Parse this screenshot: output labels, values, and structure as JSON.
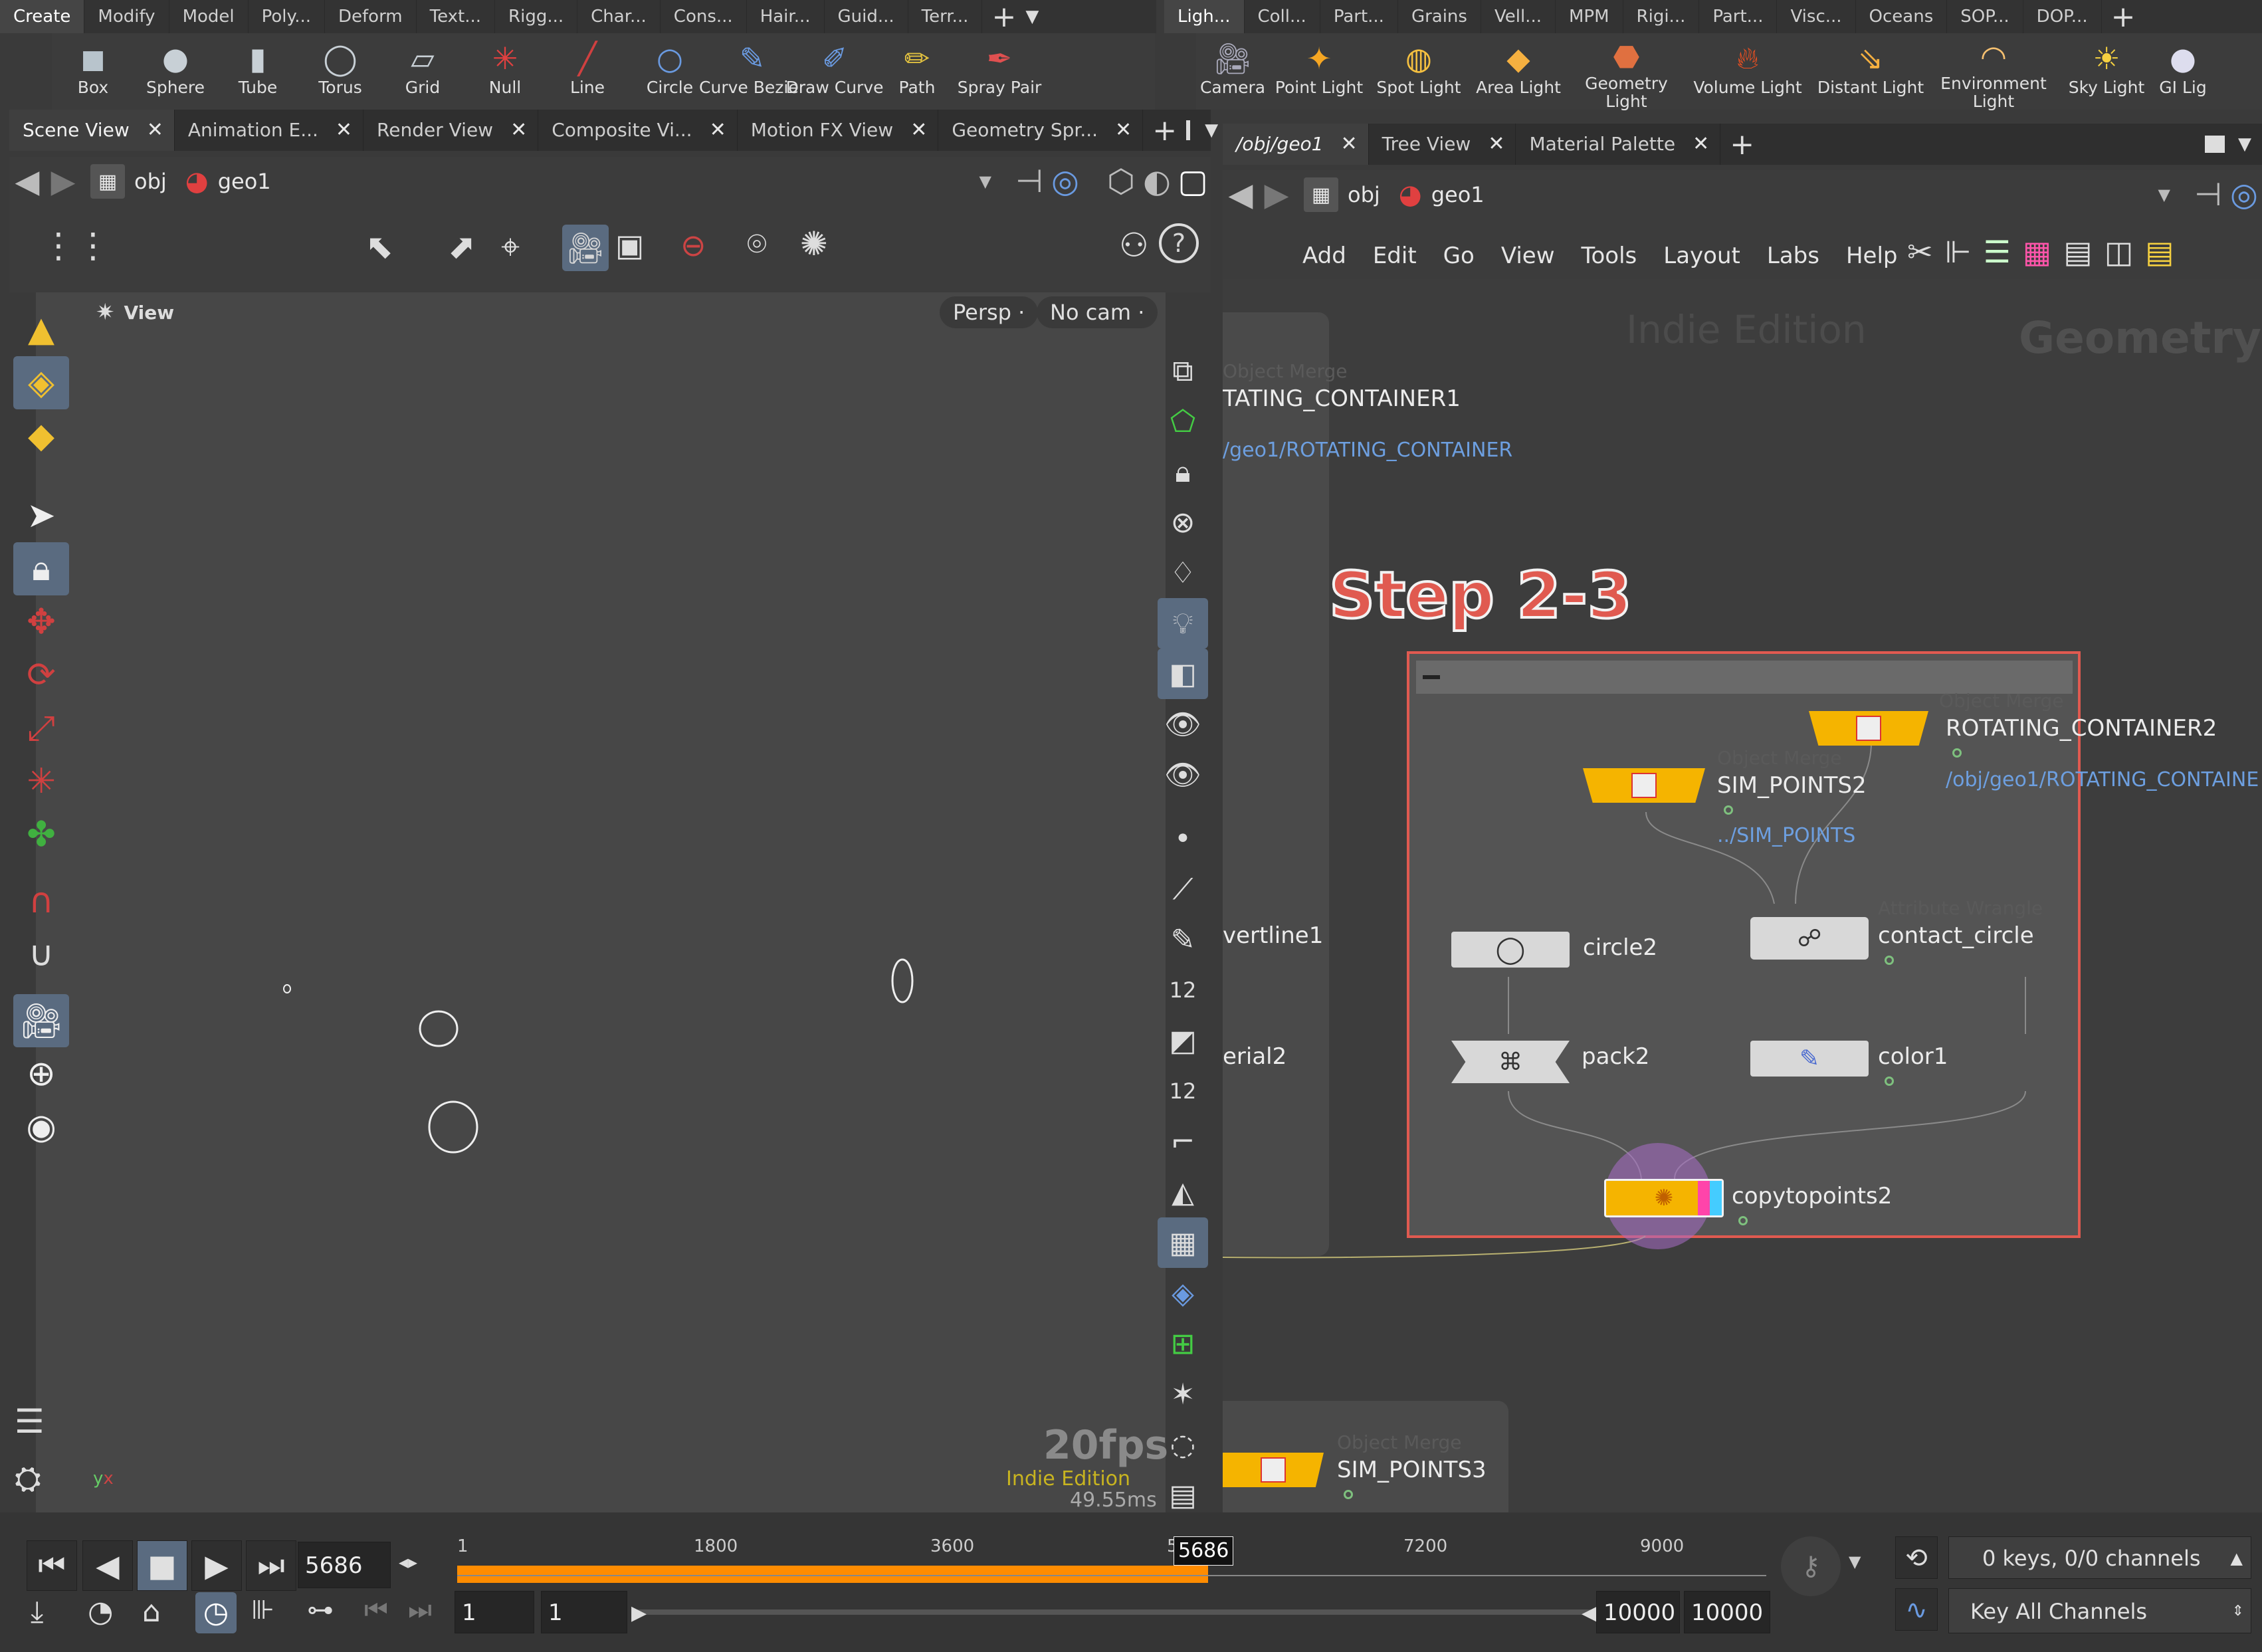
{
  "shelf_left": {
    "tabs": [
      "Create",
      "Modify",
      "Model",
      "Poly...",
      "Deform",
      "Text...",
      "Rigg...",
      "Char...",
      "Cons...",
      "Hair...",
      "Guid...",
      "Terr..."
    ],
    "tools": [
      "Box",
      "Sphere",
      "Tube",
      "Torus",
      "Grid",
      "Null",
      "Line",
      "Circle",
      "Curve Bezier",
      "Draw Curve",
      "Path",
      "Spray Pair"
    ]
  },
  "shelf_right": {
    "tabs": [
      "Ligh...",
      "Coll...",
      "Part...",
      "Grains",
      "Vell...",
      "MPM",
      "Rigi...",
      "Part...",
      "Visc...",
      "Oceans",
      "SOP...",
      "DOP..."
    ],
    "tools": [
      "Camera",
      "Point Light",
      "Spot Light",
      "Area Light",
      "Geometry Light",
      "Volume Light",
      "Distant Light",
      "Environment Light",
      "Sky Light",
      "GI Lig"
    ]
  },
  "left_pane": {
    "tabs": [
      "Scene View",
      "Animation E...",
      "Render View",
      "Composite Vi...",
      "Motion FX View",
      "Geometry Spr..."
    ],
    "path": [
      "obj",
      "geo1"
    ],
    "viewport": {
      "label": "View",
      "persp": "Persp",
      "cam": "No cam",
      "fps": "20fps",
      "edition": "Indie Edition",
      "ms": "49.55ms"
    }
  },
  "right_pane": {
    "tabs": [
      "/obj/geo1",
      "Tree View",
      "Material Palette"
    ],
    "path": [
      "obj",
      "geo1"
    ],
    "menu": [
      "Add",
      "Edit",
      "Go",
      "View",
      "Tools",
      "Layout",
      "Labs",
      "Help"
    ],
    "watermark_left": "Indie Edition",
    "watermark_right": "Geometry",
    "annotation": "Step 2-3",
    "nodes": {
      "rot1_type": "Object Merge",
      "rot1_name": "TATING_CONTAINER1",
      "rot1_path": "/geo1/ROTATING_CONTAINER",
      "vertline": "vertline1",
      "erial": "erial2",
      "rot2_type": "Object Merge",
      "rot2_name": "ROTATING_CONTAINER2",
      "rot2_path": "/obj/geo1/ROTATING_CONTAINE",
      "sim2_type": "Object Merge",
      "sim2_name": "SIM_POINTS2",
      "sim2_path": "../SIM_POINTS",
      "contact_type": "Attribute Wrangle",
      "contact_name": "contact_circle",
      "circle_name": "circle2",
      "pack_name": "pack2",
      "color_name": "color1",
      "copy_name": "copytopoints2",
      "sim3_type": "Object Merge",
      "sim3_name": "SIM_POINTS3"
    }
  },
  "timeline": {
    "frame": "5686",
    "marker": "5686",
    "ticks": [
      "1",
      "1800",
      "3600",
      "5",
      "7200",
      "9000"
    ],
    "range_start_a": "1",
    "range_start_b": "1",
    "range_end_a": "10000",
    "range_end_b": "10000",
    "keys": "0 keys, 0/0 channels",
    "key_all": "Key All Channels"
  },
  "colors": {
    "accent_orange": "#ff8c00",
    "node_yellow": "#f5b400",
    "annotation_red": "#e05a50",
    "path_blue": "#6d9fe0"
  }
}
